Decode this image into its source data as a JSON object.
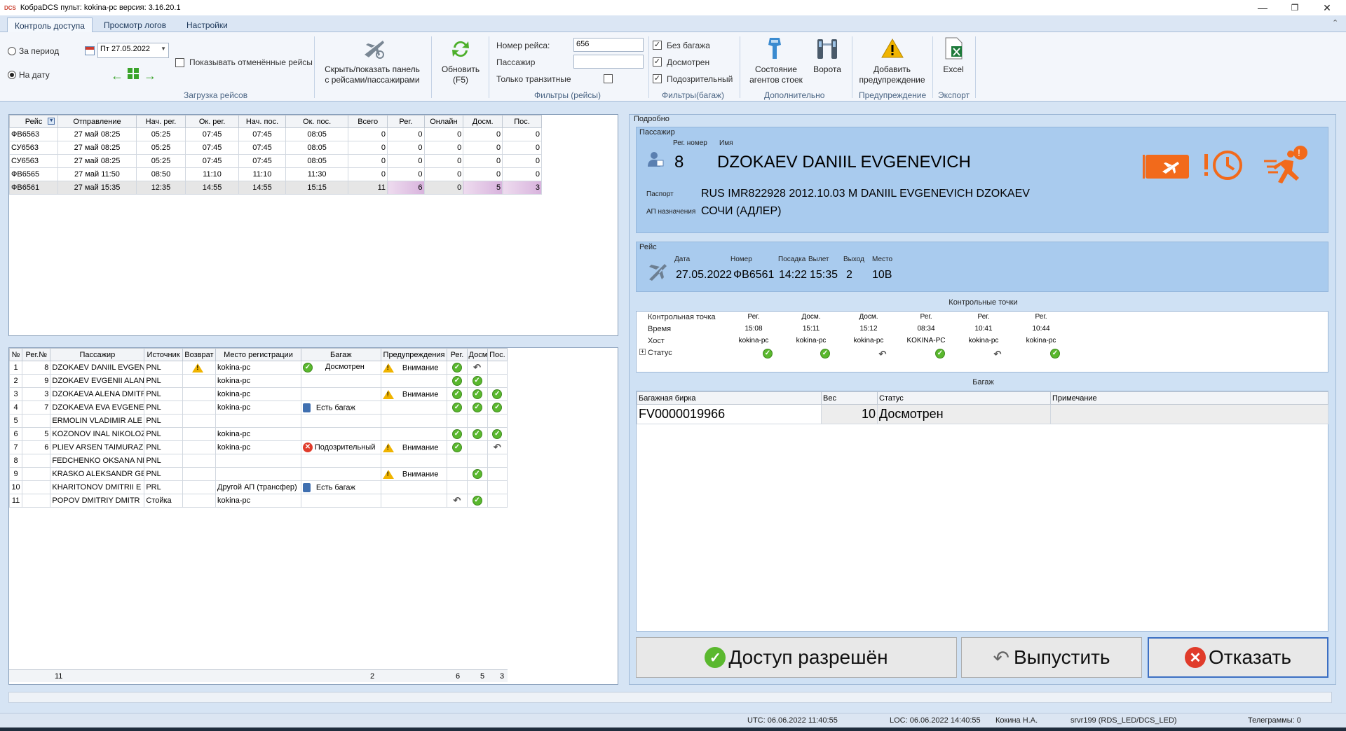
{
  "titlebar": {
    "logo": "DCS",
    "title": "КобраDCS  пульт: kokina-pc   версия: 3.16.20.1"
  },
  "tabs": [
    "Контроль доступа",
    "Просмотр логов",
    "Настройки"
  ],
  "ribbon": {
    "period_label": "За период",
    "date_label": "На дату",
    "date_value": "Пт 27.05.2022",
    "show_cancelled": "Показывать отменённые рейсы",
    "load_group": "Загрузка рейсов",
    "toggle_panel": "Скрыть/показать панель\nс рейсами/пассажирами",
    "refresh": "Обновить\n(F5)",
    "flight_no_label": "Номер рейса:",
    "flight_no_value": "656",
    "passenger_label": "Пассажир",
    "passenger_value": "",
    "transit_label": "Только транзитные",
    "filters_flights": "Фильтры (рейсы)",
    "no_bag": "Без багажа",
    "inspected": "Досмотрен",
    "suspicious": "Подозрительный",
    "filters_bag": "Фильтры(багаж)",
    "agents_state": "Состояние\nагентов стоек",
    "gates": "Ворота",
    "additional": "Дополнительно",
    "add_warning": "Добавить\nпредупреждение",
    "warning_group": "Предупреждение",
    "excel": "Excel",
    "export_group": "Экспорт"
  },
  "flights": {
    "headers": [
      "Рейс",
      "Отправление",
      "Нач. рег.",
      "Ок. рег.",
      "Нач. пос.",
      "Ок. пос.",
      "Всего",
      "Рег.",
      "Онлайн",
      "Досм.",
      "Пос."
    ],
    "rows": [
      [
        "ФВ6563",
        "27 май 08:25",
        "05:25",
        "07:45",
        "07:45",
        "08:05",
        "0",
        "0",
        "0",
        "0",
        "0"
      ],
      [
        "СУ6563",
        "27 май 08:25",
        "05:25",
        "07:45",
        "07:45",
        "08:05",
        "0",
        "0",
        "0",
        "0",
        "0"
      ],
      [
        "СУ6563",
        "27 май 08:25",
        "05:25",
        "07:45",
        "07:45",
        "08:05",
        "0",
        "0",
        "0",
        "0",
        "0"
      ],
      [
        "ФВ6565",
        "27 май 11:50",
        "08:50",
        "11:10",
        "11:10",
        "11:30",
        "0",
        "0",
        "0",
        "0",
        "0"
      ],
      [
        "ФВ6561",
        "27 май 15:35",
        "12:35",
        "14:55",
        "14:55",
        "15:15",
        "11",
        "6",
        "0",
        "5",
        "3"
      ]
    ]
  },
  "passengers": {
    "headers": [
      "№",
      "Рег.№",
      "Пассажир",
      "Источник",
      "Возврат",
      "Место регистрации",
      "Багаж",
      "Предупреждения",
      "Рег.",
      "Досм.",
      "Пос."
    ],
    "rows": [
      {
        "n": "1",
        "reg": "8",
        "name": "DZOKAEV DANIIL EVGEN",
        "src": "PNL",
        "ret": "warn",
        "place": "kokina-pc",
        "bag": "Досмотрен",
        "bag_icon": "ok",
        "warn": "Внимание",
        "r": "ok",
        "d": "back",
        "p": ""
      },
      {
        "n": "2",
        "reg": "9",
        "name": "DZOKAEV EVGENII ALAN",
        "src": "PNL",
        "ret": "",
        "place": "kokina-pc",
        "bag": "",
        "bag_icon": "",
        "warn": "",
        "r": "ok",
        "d": "ok",
        "p": ""
      },
      {
        "n": "3",
        "reg": "3",
        "name": "DZOKAEVA ALENA DMITR",
        "src": "PNL",
        "ret": "",
        "place": "kokina-pc",
        "bag": "",
        "bag_icon": "",
        "warn": "Внимание",
        "r": "ok",
        "d": "ok",
        "p": "ok"
      },
      {
        "n": "4",
        "reg": "7",
        "name": "DZOKAEVA EVA EVGENEV",
        "src": "PNL",
        "ret": "",
        "place": "kokina-pc",
        "bag": "Есть багаж",
        "bag_icon": "bag",
        "warn": "",
        "r": "ok",
        "d": "ok",
        "p": "ok"
      },
      {
        "n": "5",
        "reg": "",
        "name": "ERMOLIN VLADIMIR ALE",
        "src": "PNL",
        "ret": "",
        "place": "",
        "bag": "",
        "bag_icon": "",
        "warn": "",
        "r": "",
        "d": "",
        "p": ""
      },
      {
        "n": "6",
        "reg": "5",
        "name": "KOZONOV INAL NIKOLOZ",
        "src": "PNL",
        "ret": "",
        "place": "kokina-pc",
        "bag": "",
        "bag_icon": "",
        "warn": "",
        "r": "ok",
        "d": "ok",
        "p": "ok"
      },
      {
        "n": "7",
        "reg": "6",
        "name": "PLIEV ARSEN TAIMURAZ",
        "src": "PNL",
        "ret": "",
        "place": "kokina-pc",
        "bag": "Подозрительный",
        "bag_icon": "x",
        "warn": "Внимание",
        "r": "ok",
        "d": "",
        "p": "back"
      },
      {
        "n": "8",
        "reg": "",
        "name": "FEDCHENKO OKSANA NIK",
        "src": "PNL",
        "ret": "",
        "place": "",
        "bag": "",
        "bag_icon": "",
        "warn": "",
        "r": "",
        "d": "",
        "p": ""
      },
      {
        "n": "9",
        "reg": "",
        "name": "KRASKO ALEKSANDR GEN",
        "src": "PNL",
        "ret": "",
        "place": "",
        "bag": "",
        "bag_icon": "",
        "warn": "Внимание",
        "r": "",
        "d": "ok",
        "p": ""
      },
      {
        "n": "10",
        "reg": "",
        "name": "KHARITONOV DMITRII E",
        "src": "PRL",
        "ret": "",
        "place": "Другой АП (трансфер)",
        "bag": "Есть багаж",
        "bag_icon": "bag",
        "warn": "",
        "r": "",
        "d": "",
        "p": ""
      },
      {
        "n": "11",
        "reg": "",
        "name": "POPOV DMITRIY  DMITR",
        "src": "Стойка",
        "ret": "",
        "place": "kokina-pc",
        "bag": "",
        "bag_icon": "",
        "warn": "",
        "r": "back",
        "d": "ok",
        "p": ""
      }
    ],
    "footer": {
      "count": "11",
      "bags": "2",
      "reg": "6",
      "insp": "5",
      "board": "3"
    }
  },
  "details": {
    "title": "Подробно",
    "passenger_section": "Пассажир",
    "reg_no_label": "Рег. номер",
    "name_label": "Имя",
    "reg_no": "8",
    "name": "DZOKAEV DANIIL EVGENEVICH",
    "passport_label": "Паспорт",
    "passport": "RUS IMR822928 2012.10.03 M DANIIL EVGENEVICH DZOKAEV",
    "dest_label": "АП назначения",
    "dest": "СОЧИ (АДЛЕР)",
    "flight_section": "Рейс",
    "date_label": "Дата",
    "number_label": "Номер",
    "boarding_label": "Посадка",
    "departure_label": "Вылет",
    "exit_label": "Выход",
    "seat_label": "Место",
    "date": "27.05.2022",
    "number": "ФВ6561",
    "boarding": "14:22",
    "departure": "15:35",
    "exit": "2",
    "seat": "10B"
  },
  "checkpoints": {
    "title": "Контрольные точки",
    "row_labels": [
      "Контрольная точка",
      "Время",
      "Хост",
      "Статус"
    ],
    "items": [
      {
        "type": "Рег.",
        "time": "15:08",
        "host": "kokina-pc",
        "status": "ok"
      },
      {
        "type": "Досм.",
        "time": "15:11",
        "host": "kokina-pc",
        "status": "ok"
      },
      {
        "type": "Досм.",
        "time": "15:12",
        "host": "kokina-pc",
        "status": "back"
      },
      {
        "type": "Рег.",
        "time": "08:34",
        "host": "KOKINA-PC",
        "status": "ok"
      },
      {
        "type": "Рег.",
        "time": "10:41",
        "host": "kokina-pc",
        "status": "back"
      },
      {
        "type": "Рег.",
        "time": "10:44",
        "host": "kokina-pc",
        "status": "ok"
      }
    ]
  },
  "baggage": {
    "title": "Багаж",
    "headers": [
      "Багажная бирка",
      "Вес",
      "Статус",
      "Примечание"
    ],
    "rows": [
      [
        "FV0000019966",
        "10",
        "Досмотрен",
        ""
      ]
    ]
  },
  "actions": {
    "allow": "Доступ разрешён",
    "release": "Выпустить",
    "deny": "Отказать"
  },
  "status_bar": {
    "utc": "UTC: 06.06.2022 11:40:55",
    "loc": "LOC: 06.06.2022 14:40:55",
    "user": "Кокина Н.А.",
    "server": "srvr199 (RDS_LED/DCS_LED)",
    "telegrams": "Телеграммы: 0"
  },
  "colors": {
    "accent_orange": "#f26a1b",
    "ok_green": "#5ab82e",
    "panel_blue": "#a9cbee",
    "warn_yellow": "#f0b400",
    "deny_red": "#e03b2a"
  }
}
